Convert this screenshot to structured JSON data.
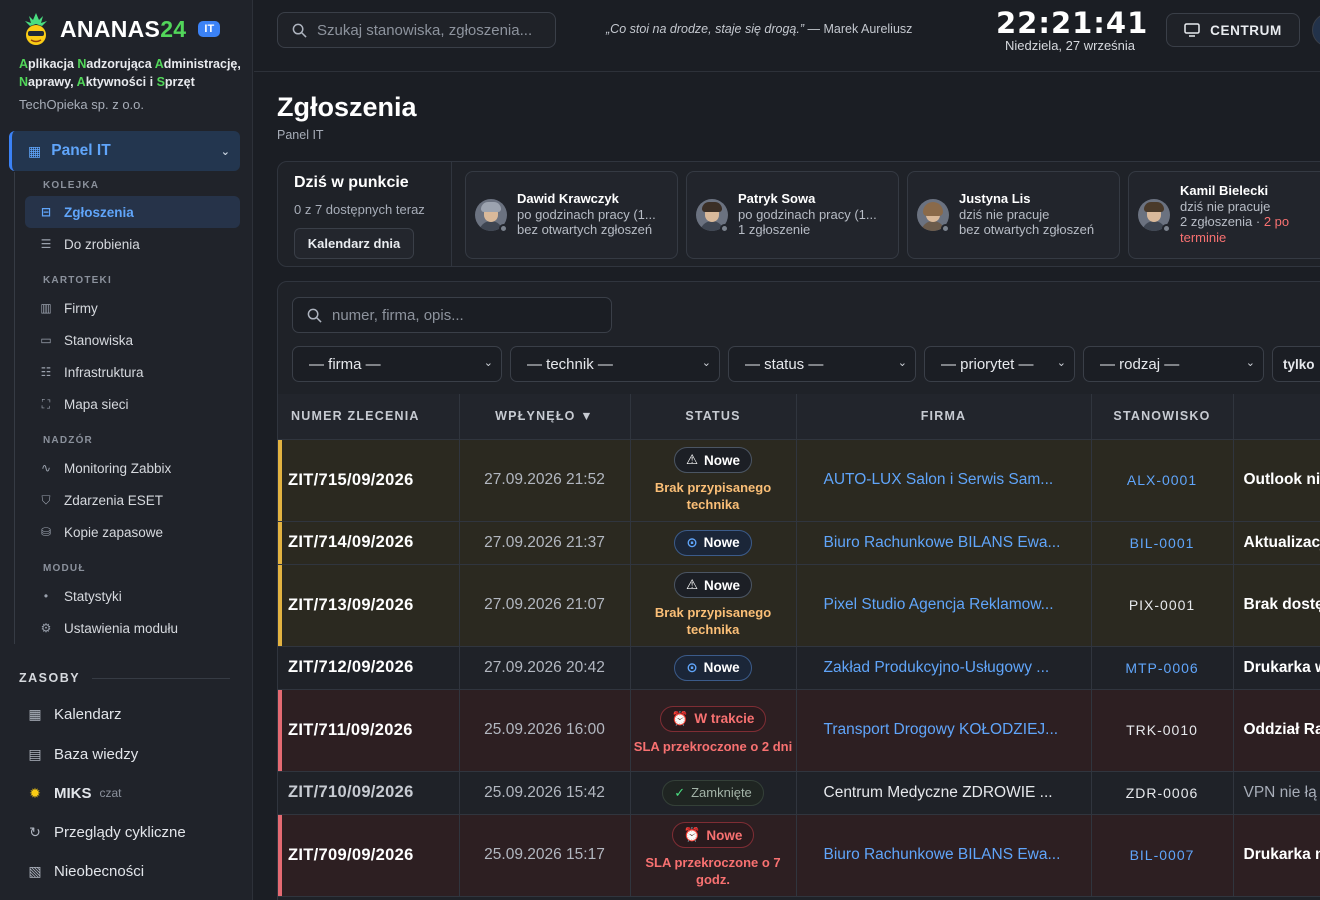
{
  "sidebar": {
    "brand": {
      "name_a": "ANANAS",
      "name_b": "24",
      "badge": "IT"
    },
    "acronym": [
      {
        "b": "A",
        "r": "plikacja "
      },
      {
        "b": "N",
        "r": "adzorująca "
      },
      {
        "b": "A",
        "r": "dministrację, "
      },
      {
        "b": "N",
        "r": "aprawy, "
      },
      {
        "b": "A",
        "r": "ktywności i "
      },
      {
        "b": "S",
        "r": "przęt"
      }
    ],
    "company": "TechOpieka sp. z o.o.",
    "panel": {
      "label": "Panel IT",
      "icon": "grid-icon"
    },
    "sections": {
      "kolejka": "KOLEJKA",
      "kartoteki": "KARTOTEKI",
      "nadzor": "NADZÓR",
      "modul": "MODUŁ"
    },
    "items": {
      "zgloszenia": "Zgłoszenia",
      "do_zrobienia": "Do zrobienia",
      "firmy": "Firmy",
      "stanowiska": "Stanowiska",
      "infrastruktura": "Infrastruktura",
      "mapa_sieci": "Mapa sieci",
      "monitoring": "Monitoring Zabbix",
      "eset": "Zdarzenia ESET",
      "kopie": "Kopie zapasowe",
      "statystyki": "Statystyki",
      "ustawienia": "Ustawienia modułu"
    },
    "zasoby": {
      "title": "ZASOBY",
      "kalendarz": "Kalendarz",
      "baza": "Baza wiedzy",
      "miks": "MIKS",
      "czat": "czat",
      "przeglady": "Przeglądy cykliczne",
      "nieobecnosci": "Nieobecności"
    }
  },
  "topbar": {
    "search_placeholder": "Szukaj stanowiska, zgłoszenia...",
    "quote": "„Co stoi na drodze, staje się drogą.”",
    "quote_author": " — Marek Aureliusz",
    "time": "22:21:41",
    "date": "Niedziela, 27 września",
    "centrum": "CENTRUM"
  },
  "page": {
    "title": "Zgłoszenia",
    "subtitle": "Panel IT"
  },
  "today": {
    "title": "Dziś w punkcie",
    "available": "0 z 7 dostępnych teraz",
    "calendar_btn": "Kalendarz dnia",
    "techs": [
      {
        "name": "Dawid Krawczyk",
        "l2": "po godzinach pracy (1...",
        "l3": "bez otwartych zgłoszeń",
        "late": ""
      },
      {
        "name": "Patryk Sowa",
        "l2": "po godzinach pracy (1...",
        "l3": "1 zgłoszenie",
        "late": ""
      },
      {
        "name": "Justyna Lis",
        "l2": "dziś nie pracuje",
        "l3": "bez otwartych zgłoszeń",
        "late": ""
      },
      {
        "name": "Kamil Bielecki",
        "l2": "dziś nie pracuje",
        "l3": "2 zgłoszenia · ",
        "late": "2 po terminie"
      }
    ]
  },
  "filters": {
    "search_placeholder": "numer, firma, opis...",
    "firma": "— firma —",
    "technik": "— technik —",
    "status": "— status —",
    "priorytet": "— priorytet —",
    "rodzaj": "— rodzaj —",
    "tylko": "tylko"
  },
  "table": {
    "headers": {
      "numer": "NUMER ZLECENIA",
      "wplynelo": "WPŁYNĘŁO ▼",
      "status": "STATUS",
      "firma": "FIRMA",
      "stanowisko": "STANOWISKO"
    },
    "rows": [
      {
        "num": "ZIT/715/09/2026",
        "date": "27.09.2026 21:52",
        "status": "Nowe",
        "note": "Brak przypisanego technika",
        "firm": "AUTO-LUX Salon i Serwis Sam...",
        "stan": "ALX-0001",
        "desc": "Outlook nie"
      },
      {
        "num": "ZIT/714/09/2026",
        "date": "27.09.2026 21:37",
        "status": "Nowe",
        "note": "",
        "firm": "Biuro Rachunkowe BILANS Ewa...",
        "stan": "BIL-0001",
        "desc": "Aktualizacj"
      },
      {
        "num": "ZIT/713/09/2026",
        "date": "27.09.2026 21:07",
        "status": "Nowe",
        "note": "Brak przypisanego technika",
        "firm": "Pixel Studio Agencja Reklamow...",
        "stan": "PIX-0001",
        "desc": "Brak dostę"
      },
      {
        "num": "ZIT/712/09/2026",
        "date": "27.09.2026 20:42",
        "status": "Nowe",
        "note": "",
        "firm": "Zakład Produkcyjno-Usługowy ...",
        "stan": "MTP-0006",
        "desc": "Drukarka w"
      },
      {
        "num": "ZIT/711/09/2026",
        "date": "25.09.2026 16:00",
        "status": "W trakcie",
        "note": "SLA przekroczone o 2 dni",
        "firm": "Transport Drogowy KOŁODZIEJ...",
        "stan": "TRK-0010",
        "desc": "Oddział Ra"
      },
      {
        "num": "ZIT/710/09/2026",
        "date": "25.09.2026 15:42",
        "status": "Zamknięte",
        "note": "",
        "firm": "Centrum Medyczne ZDROWIE ...",
        "stan": "ZDR-0006",
        "desc": "VPN nie łą"
      },
      {
        "num": "ZIT/709/09/2026",
        "date": "25.09.2026 15:17",
        "status": "Nowe",
        "note": "SLA przekroczone o 7 godz.",
        "firm": "Biuro Rachunkowe BILANS Ewa...",
        "stan": "BIL-0007",
        "desc": "Drukarka n"
      }
    ]
  },
  "colors": {
    "accent": "#3b82f6",
    "link": "#60a5fa",
    "warn": "#e3b341",
    "error": "#e46a72",
    "ok": "#4ade80",
    "brand_green": "#52d65a"
  }
}
